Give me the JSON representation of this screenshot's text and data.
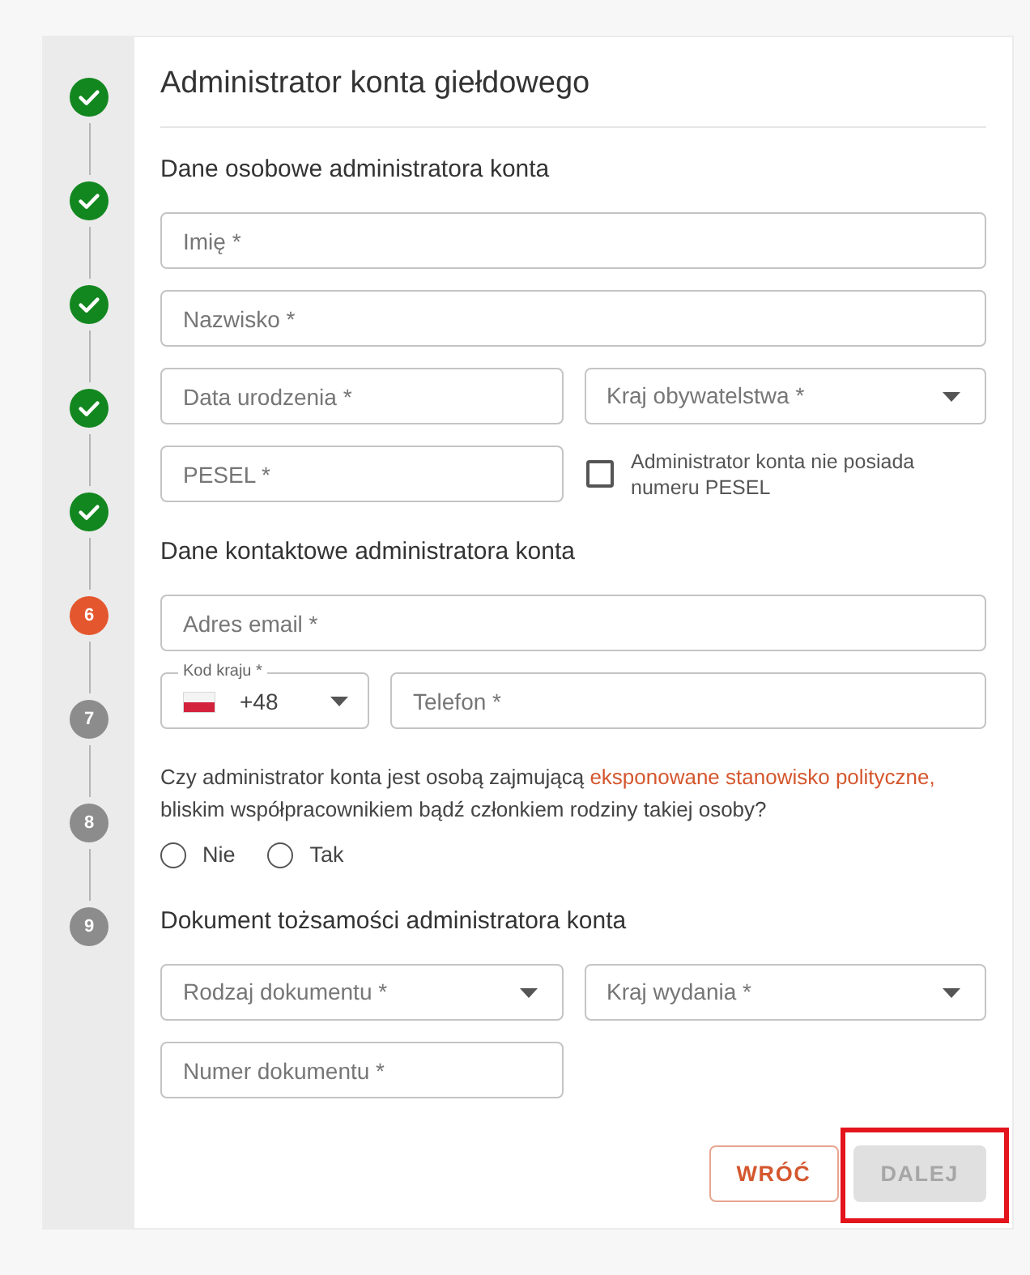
{
  "steps": [
    {
      "completed": true,
      "current": false
    },
    {
      "completed": true,
      "current": false
    },
    {
      "completed": true,
      "current": false
    },
    {
      "completed": true,
      "current": false
    },
    {
      "completed": true,
      "current": false
    },
    {
      "completed": false,
      "current": true,
      "number": "6"
    },
    {
      "completed": false,
      "current": false,
      "number": "7"
    },
    {
      "completed": false,
      "current": false,
      "number": "8"
    },
    {
      "completed": false,
      "current": false,
      "number": "9"
    }
  ],
  "title": "Administrator konta giełdowego",
  "sections": [
    {
      "heading": "Dane osobowe administratora konta",
      "rows": [
        [
          {
            "kind": "text",
            "placeholder": "Imię *",
            "full_width": true
          }
        ],
        [
          {
            "kind": "text",
            "placeholder": "Nazwisko *",
            "full_width": true
          }
        ],
        [
          {
            "kind": "text",
            "placeholder": "Data urodzenia *"
          },
          {
            "kind": "select",
            "placeholder": "Kraj obywatelstwa *"
          }
        ],
        [
          {
            "kind": "text",
            "placeholder": "PESEL *"
          },
          {
            "kind": "checkbox",
            "label": "Administrator konta nie posiada numeru PESEL",
            "checked": false
          }
        ]
      ]
    },
    {
      "heading": "Dane kontaktowe administratora konta",
      "rows": [
        [
          {
            "kind": "text",
            "placeholder": "Adres email *",
            "full_width": true
          }
        ],
        [
          {
            "kind": "phone_code",
            "label": "Kod kraju *",
            "value": "+48"
          },
          {
            "kind": "text",
            "placeholder": "Telefon *"
          }
        ]
      ],
      "question": {
        "text_before": "Czy administrator konta jest osobą zajmującą",
        "link": "eksponowane stanowisko polityczne,",
        "text_after": "bliskim współpracownikiem bądź członkiem rodziny takiej osoby?",
        "options": [
          {
            "label": "Nie",
            "selected": false
          },
          {
            "label": "Tak",
            "selected": false
          }
        ]
      }
    },
    {
      "heading": "Dokument tożsamości administratora konta",
      "rows": [
        [
          {
            "kind": "select",
            "placeholder": "Rodzaj dokumentu *"
          },
          {
            "kind": "select",
            "placeholder": "Kraj wydania *"
          }
        ],
        [
          {
            "kind": "text",
            "placeholder": "Numer dokumentu *"
          }
        ]
      ]
    }
  ],
  "buttons": [
    {
      "label": "WRÓĆ",
      "kind": "secondary",
      "disabled": false,
      "highlighted": false
    },
    {
      "label": "DALEJ",
      "kind": "primary",
      "disabled": true,
      "highlighted": true
    }
  ]
}
